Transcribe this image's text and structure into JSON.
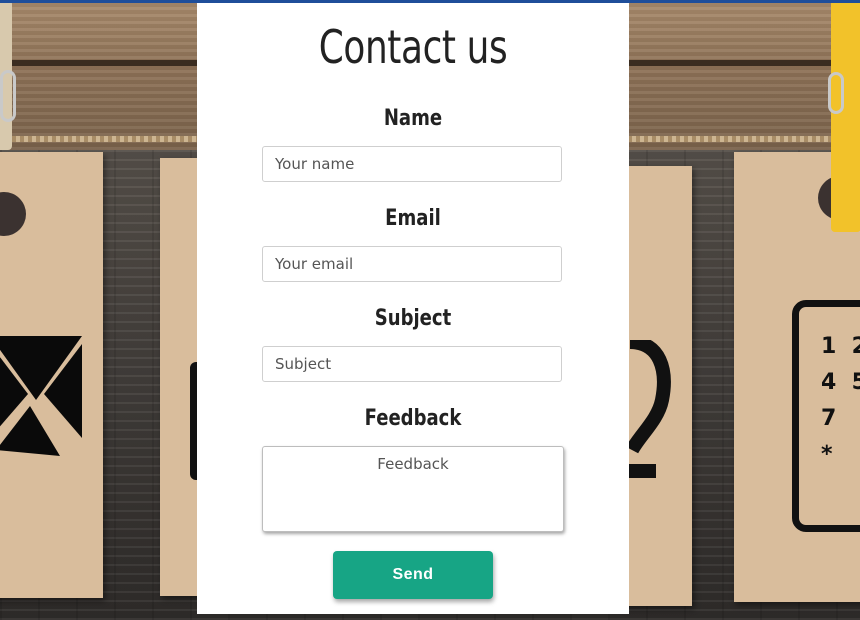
{
  "form": {
    "title": "Contact us",
    "name": {
      "label": "Name",
      "placeholder": "Your name"
    },
    "email": {
      "label": "Email",
      "placeholder": "Your email"
    },
    "subject": {
      "label": "Subject",
      "placeholder": "Subject"
    },
    "feedback": {
      "label": "Feedback",
      "placeholder": "Feedback"
    },
    "send_label": "Send"
  },
  "background": {
    "keypad_digits": [
      "1",
      "2",
      "4",
      "5",
      "7",
      "*"
    ]
  },
  "colors": {
    "accent": "#17a585",
    "top_bar": "#1f4e9a",
    "panel": "#ffffff",
    "text": "#222222"
  }
}
